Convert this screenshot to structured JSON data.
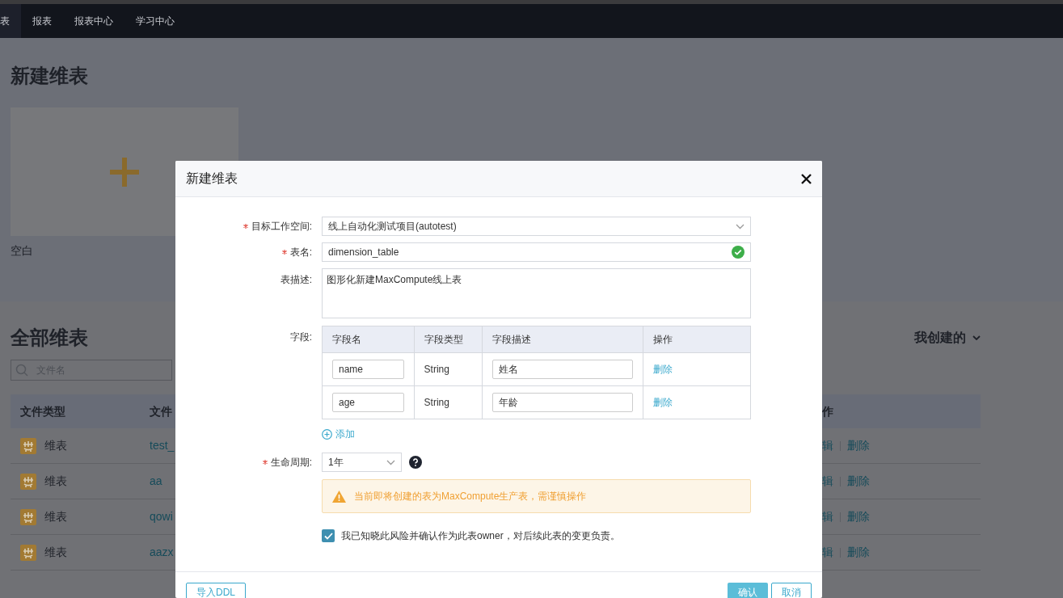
{
  "nav": {
    "tabs": [
      {
        "label": "表",
        "selected": true
      },
      {
        "label": "报表",
        "selected": false
      },
      {
        "label": "报表中心",
        "selected": false
      },
      {
        "label": "学习中心",
        "selected": false
      }
    ]
  },
  "new_section": {
    "title": "新建维表",
    "card_label": "空白"
  },
  "list_section": {
    "title": "全部维表",
    "search": {
      "placeholder": "文件名"
    },
    "filter": "我创建的",
    "table": {
      "columns": [
        "文件类型",
        "文件",
        "作"
      ],
      "rows": [
        {
          "type": "维表",
          "name": "test_",
          "actions": [
            "辑",
            "删除"
          ]
        },
        {
          "type": "维表",
          "name": "aa",
          "actions": [
            "辑",
            "删除"
          ]
        },
        {
          "type": "维表",
          "name": "qowi",
          "actions": [
            "辑",
            "删除"
          ]
        },
        {
          "type": "维表",
          "name": "aazx",
          "actions": [
            "辑",
            "删除"
          ]
        }
      ]
    }
  },
  "dialog": {
    "title": "新建维表",
    "workspace": {
      "label": "目标工作空间:",
      "required": true,
      "value": "线上自动化测试项目(autotest)"
    },
    "table_name": {
      "label": "表名:",
      "required": true,
      "value": "dimension_table",
      "valid": true
    },
    "description": {
      "label": "表描述:",
      "required": false,
      "value": "图形化新建MaxCompute线上表"
    },
    "fields": {
      "label": "字段:",
      "columns": [
        "字段名",
        "字段类型",
        "字段描述",
        "操作"
      ],
      "rows": [
        {
          "name": "name",
          "type": "String",
          "description": "姓名",
          "action": "删除"
        },
        {
          "name": "age",
          "type": "String",
          "description": "年龄",
          "action": "删除"
        }
      ],
      "add_label": "添加"
    },
    "lifecycle": {
      "label": "生命周期:",
      "required": true,
      "value": "1年"
    },
    "warning": "当前即将创建的表为MaxCompute生产表，需谨慎操作",
    "acknowledge": {
      "label": "我已知晓此风险并确认作为此表owner，对后续此表的变更负责。",
      "checked": true
    },
    "buttons": {
      "import": "导入DDL",
      "confirm": "确认",
      "cancel": "取消"
    }
  }
}
